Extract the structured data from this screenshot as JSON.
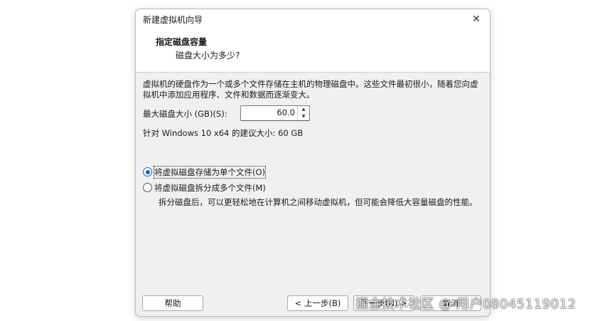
{
  "window": {
    "title": "新建虚拟机向导",
    "close_glyph": "✕"
  },
  "header": {
    "title": "指定磁盘容量",
    "subtitle": "磁盘大小为多少?"
  },
  "body": {
    "description": "虚拟机的硬盘作为一个或多个文件存储在主机的物理磁盘中。这些文件最初很小，随着您向虚拟机中添加应用程序、文件和数据而逐渐变大。",
    "max_size_label": "最大磁盘大小 (GB)(S):",
    "max_size_value": "60.0",
    "recommendation": "针对 Windows 10 x64 的建议大小: 60 GB",
    "options": [
      {
        "label": "将虚拟磁盘存储为单个文件(O)",
        "checked": true
      },
      {
        "label": "将虚拟磁盘拆分成多个文件(M)",
        "checked": false
      }
    ],
    "split_note": "拆分磁盘后，可以更轻松地在计算机之间移动虚拟机，但可能会降低大容量磁盘的性能。"
  },
  "footer": {
    "help_label": "帮助",
    "back_label": "< 上一步(B)",
    "next_label": "下一步(N) >",
    "cancel_label": "取消"
  },
  "watermark": "掘金技术社区 @ 用户08045119012",
  "colors": {
    "accent": "#1060c0",
    "dialog_bg": "#f0f0f0",
    "header_bg": "#ffffff"
  }
}
